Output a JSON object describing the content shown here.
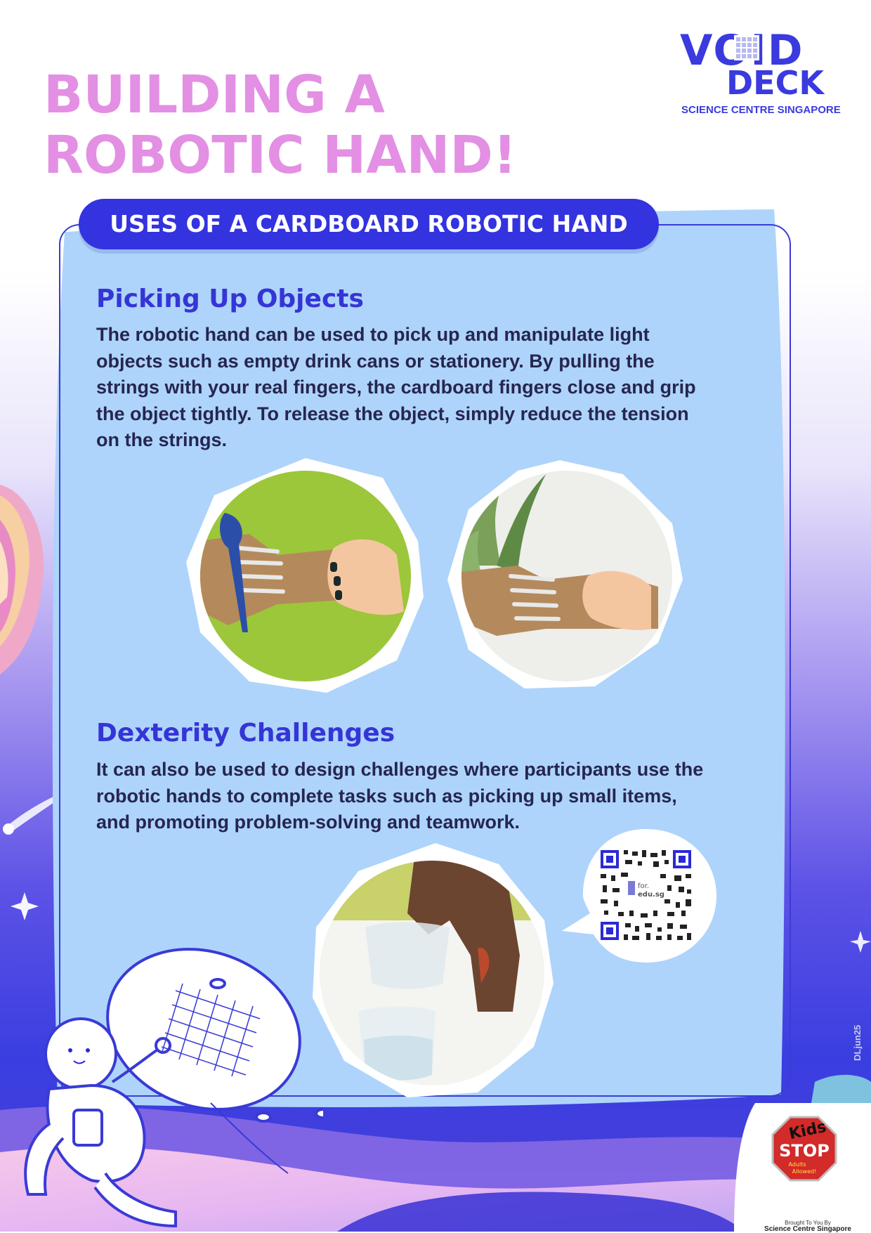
{
  "title": {
    "line1": "BUILDING A",
    "line2": "ROBOTIC HAND!"
  },
  "logo": {
    "void": "VOID",
    "deck": "DECK",
    "subtitle": "SCIENCE CENTRE SINGAPORE"
  },
  "banner": "USES OF A CARDBOARD ROBOTIC HAND",
  "sections": [
    {
      "heading": "Picking Up Objects",
      "lines": [
        "The robotic hand can be used to pick up and manipulate light",
        "objects such as empty drink cans or stationery. By pulling the",
        "strings with your real fingers, the cardboard fingers close and grip",
        "the object tightly. To release the object, simply reduce the tension",
        "on the strings."
      ]
    },
    {
      "heading": "Dexterity Challenges",
      "lines": [
        "It can also be used to design challenges where participants use the",
        "robotic hands to complete tasks such as picking up small items,",
        "and promoting problem-solving and teamwork."
      ]
    }
  ],
  "qr": {
    "label_top": "for.",
    "label_bottom": "edu.sg"
  },
  "side_tag": "DLjun25",
  "sponsor": {
    "stop_top": "Kids",
    "stop_main": "STOP",
    "stop_sub1": "Adults",
    "stop_sub2": "Allowed!",
    "brought_by": "Brought To You By",
    "org": "Science Centre Singapore"
  },
  "colors": {
    "title": "#e38fe3",
    "brand_blue": "#3a3adf",
    "panel": "#aed4fb",
    "text": "#262650"
  }
}
